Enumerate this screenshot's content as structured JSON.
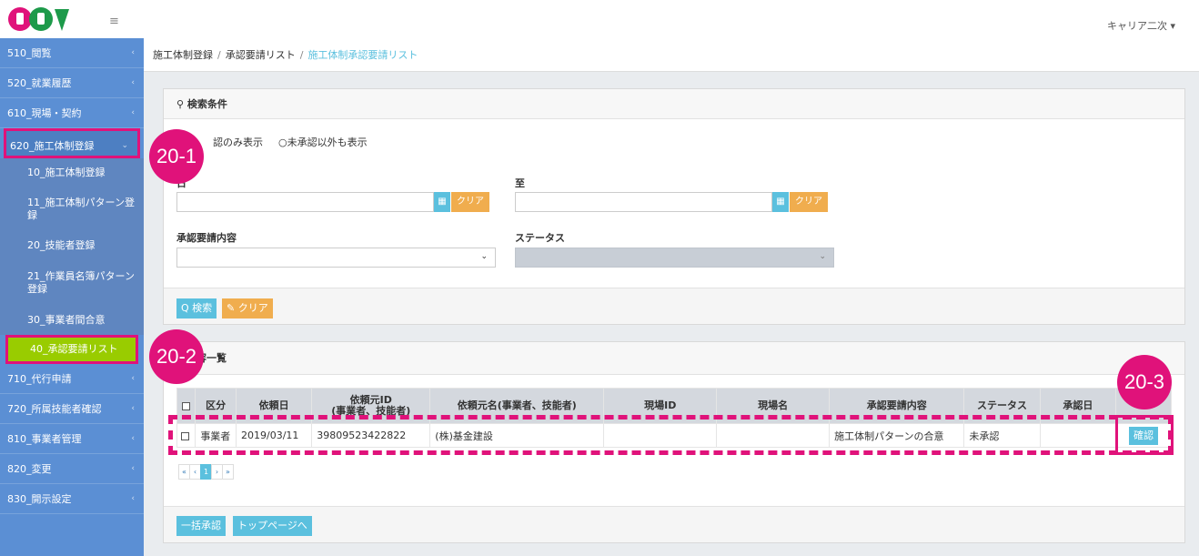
{
  "header": {
    "user_menu": "キャリア二次 ▾",
    "hamburger": "≡"
  },
  "sidebar": {
    "items": [
      {
        "label": "510_閲覧",
        "chev": "‹"
      },
      {
        "label": "520_就業履歴",
        "chev": "‹"
      },
      {
        "label": "610_現場・契約",
        "chev": "‹"
      },
      {
        "label": "620_施工体制登録",
        "chev": "⌄"
      },
      {
        "label": "10_施工体制登録"
      },
      {
        "label": "11_施工体制パターン登録"
      },
      {
        "label": "20_技能者登録"
      },
      {
        "label": "21_作業員名簿パターン登録"
      },
      {
        "label": "30_事業者間合意"
      },
      {
        "label": "40_承認要請リスト"
      },
      {
        "label": "710_代行申請",
        "chev": "‹"
      },
      {
        "label": "720_所属技能者確認",
        "chev": "‹"
      },
      {
        "label": "810_事業者管理",
        "chev": "‹"
      },
      {
        "label": "820_変更",
        "chev": "‹"
      },
      {
        "label": "830_開示設定",
        "chev": "‹"
      }
    ]
  },
  "breadcrumb": {
    "items": [
      "施工体制登録",
      "承認要請リスト",
      "施工体制承認要請リスト"
    ],
    "sep": "/"
  },
  "search": {
    "title": "検索条件",
    "icon": "search-icon",
    "radio1": "認のみ表示",
    "radio2": "○未承認以外も表示",
    "from_label": "日",
    "to_label": "至",
    "clear_label": "クリア",
    "content_label": "承認要請内容",
    "status_label": "ステータス",
    "search_button": "Q 検索",
    "clear_button": "✎ クリア",
    "calendar_icon": "▦"
  },
  "list": {
    "title": "請内容一覧",
    "columns": [
      "",
      "区分",
      "依頼日",
      "依頼元ID\n(事業者、技能者)",
      "依頼元名(事業者、技能者)",
      "現場ID",
      "現場名",
      "承認要請内容",
      "ステータス",
      "承認日",
      ""
    ],
    "col_id_line1": "依頼元ID",
    "col_id_line2": "(事業者、技能者)",
    "rows": [
      {
        "type": "事業者",
        "date": "2019/03/11",
        "requester_id": "39809523422822",
        "requester_name": "(株)基金建設",
        "site_id": "",
        "site_name": "",
        "content": "施工体制パターンの合意",
        "status": "未承認",
        "approved": "",
        "action": "確認"
      }
    ],
    "pager": [
      "«",
      "‹",
      "1",
      "›",
      "»"
    ],
    "bulk_button": "一括承認",
    "top_button": "トップページへ"
  },
  "annotations": {
    "b1": "20-1",
    "b2": "20-2",
    "b3": "20-3"
  },
  "colors": {
    "sidebar": "#5b8fd4",
    "accent": "#e0127a",
    "active": "#99cc00",
    "info": "#5bc0de",
    "warn": "#f0ad4e"
  }
}
